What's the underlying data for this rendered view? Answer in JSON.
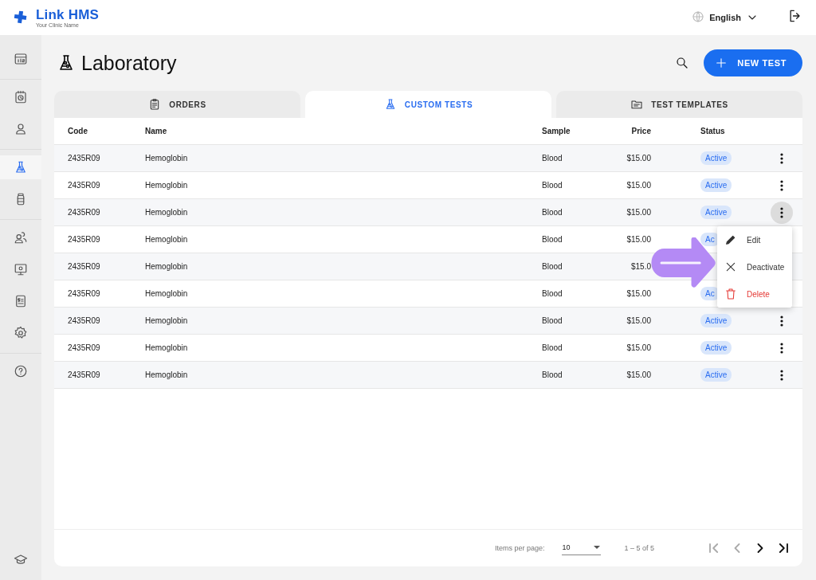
{
  "header": {
    "brand": "Link HMS",
    "tagline": "Your Clinic Name",
    "language": "English"
  },
  "sidebar": {
    "groups": [
      [
        {
          "selected": false
        }
      ],
      [
        {
          "selected": false
        },
        {
          "selected": false
        }
      ],
      [
        {
          "selected": true
        },
        {
          "selected": false
        }
      ],
      [
        {
          "selected": false
        },
        {
          "selected": false
        },
        {
          "selected": false
        },
        {
          "selected": false
        }
      ],
      [
        {
          "selected": false
        }
      ]
    ]
  },
  "page": {
    "title": "Laboratory",
    "new_button": "NEW TEST"
  },
  "tabs": [
    {
      "label": "ORDERS",
      "selected": false
    },
    {
      "label": "CUSTOM TESTS",
      "selected": true
    },
    {
      "label": "TEST TEMPLATES",
      "selected": false
    }
  ],
  "table": {
    "columns": [
      "Code",
      "Name",
      "Sample",
      "Price",
      "Status"
    ],
    "rows": [
      {
        "code": "2435R09",
        "name": "Hemoglobin",
        "sample": "Blood",
        "price": "$15.00",
        "status": "Active",
        "selected": false
      },
      {
        "code": "2435R09",
        "name": "Hemoglobin",
        "sample": "Blood",
        "price": "$15.00",
        "status": "Active",
        "selected": false
      },
      {
        "code": "2435R09",
        "name": "Hemoglobin",
        "sample": "Blood",
        "price": "$15.00",
        "status": "Active",
        "selected": true
      },
      {
        "code": "2435R09",
        "name": "Hemoglobin",
        "sample": "Blood",
        "price": "$15.00",
        "status": "Ac",
        "selected": false
      },
      {
        "code": "2435R09",
        "name": "Hemoglobin",
        "sample": "Blood",
        "price": "$15.0",
        "selected": false
      },
      {
        "code": "2435R09",
        "name": "Hemoglobin",
        "sample": "Blood",
        "price": "$15.00",
        "status": "Ac",
        "selected": false
      },
      {
        "code": "2435R09",
        "name": "Hemoglobin",
        "sample": "Blood",
        "price": "$15.00",
        "status": "Active",
        "selected": false
      },
      {
        "code": "2435R09",
        "name": "Hemoglobin",
        "sample": "Blood",
        "price": "$15.00",
        "status": "Active",
        "selected": false
      },
      {
        "code": "2435R09",
        "name": "Hemoglobin",
        "sample": "Blood",
        "price": "$15.00",
        "status": "Active",
        "selected": false
      }
    ]
  },
  "context_menu": {
    "items": [
      {
        "kind": "edit",
        "label": "Edit"
      },
      {
        "kind": "deactivate",
        "label": "Deactivate"
      },
      {
        "kind": "delete",
        "label": "Delete"
      }
    ]
  },
  "pager": {
    "label": "Items per page:",
    "page_size": "10",
    "range": "1 – 5 of 5",
    "buttons": [
      {
        "kind": "first",
        "disabled": true
      },
      {
        "kind": "prev",
        "disabled": true
      },
      {
        "kind": "next",
        "disabled": false
      },
      {
        "kind": "last",
        "disabled": false
      }
    ]
  }
}
